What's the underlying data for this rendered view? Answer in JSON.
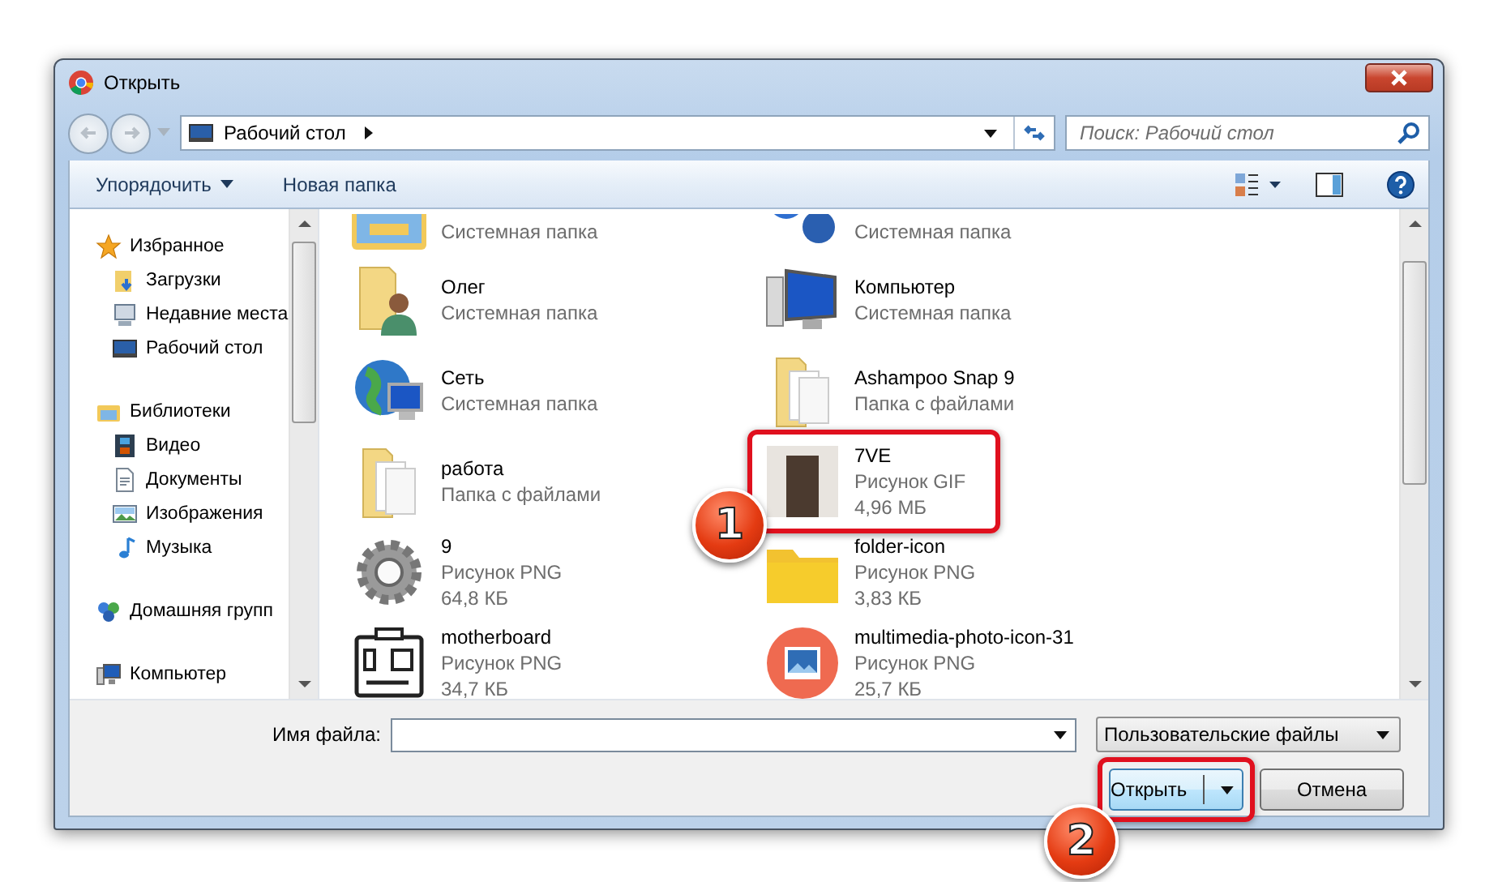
{
  "window": {
    "title": "Открыть"
  },
  "address": {
    "location": "Рабочий стол"
  },
  "search": {
    "placeholder": "Поиск: Рабочий стол"
  },
  "toolbar": {
    "organize": "Упорядочить",
    "new_folder": "Новая папка"
  },
  "sidebar": {
    "groups": [
      {
        "label": "Избранное",
        "children": [
          {
            "label": "Загрузки"
          },
          {
            "label": "Недавние места"
          },
          {
            "label": "Рабочий стол"
          }
        ]
      },
      {
        "label": "Библиотеки",
        "children": [
          {
            "label": "Видео"
          },
          {
            "label": "Документы"
          },
          {
            "label": "Изображения"
          },
          {
            "label": "Музыка"
          }
        ]
      },
      {
        "label": "Домашняя групп"
      },
      {
        "label": "Компьютер"
      }
    ]
  },
  "files": [
    {
      "type": "Системная папка",
      "highlighted": false
    },
    {
      "type": "Системная папка",
      "highlighted": false
    },
    {
      "name": "Олег",
      "type": "Системная папка",
      "highlighted": false
    },
    {
      "name": "Компьютер",
      "type": "Системная папка",
      "highlighted": false
    },
    {
      "name": "Сеть",
      "type": "Системная папка",
      "highlighted": false
    },
    {
      "name": "Ashampoo Snap 9",
      "type": "Папка с файлами",
      "highlighted": false
    },
    {
      "name": "работа",
      "type": "Папка с файлами",
      "highlighted": false
    },
    {
      "name": "7VE",
      "type": "Рисунок GIF",
      "size": "4,96 МБ",
      "highlighted": true,
      "callout": "1"
    },
    {
      "name": "9",
      "type": "Рисунок PNG",
      "size": "64,8 КБ",
      "highlighted": false
    },
    {
      "name": "folder-icon",
      "type": "Рисунок PNG",
      "size": "3,83 КБ",
      "highlighted": false
    },
    {
      "name": "motherboard",
      "type": "Рисунок PNG",
      "size": "34,7 КБ",
      "highlighted": false
    },
    {
      "name": "multimedia-photo-icon-31",
      "type": "Рисунок PNG",
      "size": "25,7 КБ",
      "highlighted": false
    }
  ],
  "footer": {
    "filename_label": "Имя файла:",
    "filter": "Пользовательские файлы",
    "open_button": {
      "label": "Открыть",
      "highlighted": true,
      "callout": "2"
    },
    "cancel_button": "Отмена"
  }
}
